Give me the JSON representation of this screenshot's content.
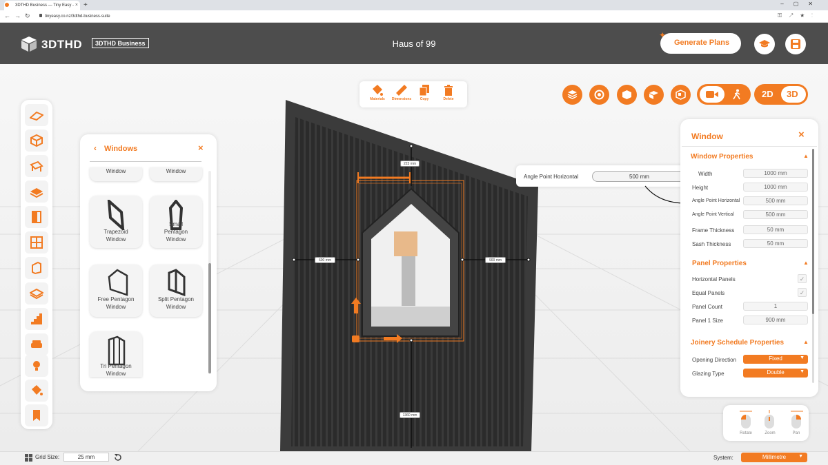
{
  "browser": {
    "tab_title": "3DTHD Business — Tiny Easy -",
    "tab_close": "×",
    "new_tab": "+",
    "url": "tinyeasy.co.nz/3dthd-business-suite"
  },
  "header": {
    "logo_text": "3DTHD",
    "badge": "3DTHD Business",
    "project_name": "Haus of 99",
    "generate_label": "Generate Plans"
  },
  "toolbar": {
    "materials": "Materials",
    "dimensions": "Dimensions",
    "copy": "Copy",
    "delete": "Delete"
  },
  "view_toggle": {
    "two_d": "2D",
    "three_d": "3D",
    "active": "3D"
  },
  "windows_panel": {
    "title": "Windows",
    "back": "‹",
    "close": "×",
    "items": [
      {
        "label": "Window"
      },
      {
        "label": "Window"
      },
      {
        "label": "Trapezoid\nWindow"
      },
      {
        "label": "Small\nPentagon\nWindow"
      },
      {
        "label": "Free Pentagon\nWindow"
      },
      {
        "label": "Split Pentagon\nWindow"
      },
      {
        "label": "Tri Pentagon\nWindow"
      }
    ]
  },
  "tooltip": {
    "label": "Angle Point Horizontal",
    "value": "500 mm"
  },
  "properties": {
    "title": "Window",
    "close": "×",
    "window_section": "Window Properties",
    "window_props": [
      {
        "label": "Width",
        "value": "1000 mm"
      },
      {
        "label": "Height",
        "value": "1000 mm"
      },
      {
        "label": "Angle Point Horizontal",
        "value": "500 mm"
      },
      {
        "label": "Angle Point Vertical",
        "value": "500 mm"
      },
      {
        "label": "Frame Thickness",
        "value": "50 mm"
      },
      {
        "label": "Sash Thickness",
        "value": "50 mm"
      }
    ],
    "panel_section": "Panel Properties",
    "panel_props": [
      {
        "label": "Horizontal Panels",
        "value": "✓"
      },
      {
        "label": "Equal Panels",
        "value": "✓"
      },
      {
        "label": "Panel Count",
        "value": "1"
      },
      {
        "label": "Panel 1 Size",
        "value": "900 mm"
      }
    ],
    "joinery_section": "Joinery Schedule Properties",
    "joinery_props": [
      {
        "label": "Opening Direction",
        "value": "Fixed"
      },
      {
        "label": "Glazing Type",
        "value": "Double"
      }
    ]
  },
  "dimensions_overlay": {
    "top": "223 mm",
    "left": "600 mm",
    "right": "900 mm",
    "bottom": "1360 mm"
  },
  "nav_controls": {
    "rotate": "Rotate",
    "zoom": "Zoom",
    "pan": "Pan"
  },
  "status_bar": {
    "grid_label": "Grid Size:",
    "grid_value": "25 mm",
    "system_label": "System:",
    "system_value": "Millimetre"
  },
  "colors": {
    "accent": "#f27b22",
    "header": "#4d4d4d",
    "wall": "#2f2f2f"
  }
}
